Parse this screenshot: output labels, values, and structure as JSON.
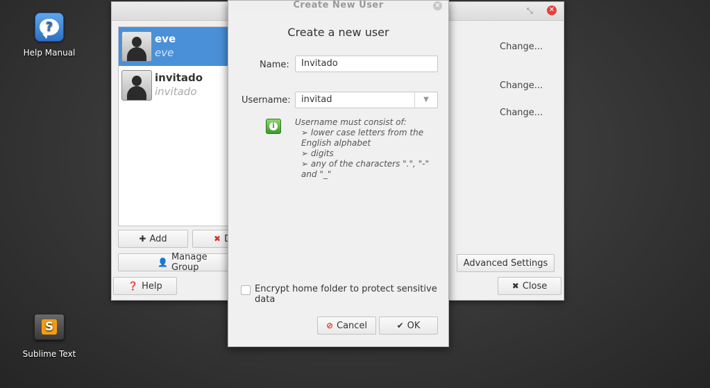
{
  "desktop": {
    "help_manual": "Help Manual",
    "sublime_text": "Sublime Text"
  },
  "users_window": {
    "users": [
      {
        "name": "eve",
        "login": "eve",
        "selected": true
      },
      {
        "name": "invitado",
        "login": "invitado",
        "selected": false
      }
    ],
    "add_label": "Add",
    "delete_label": "D",
    "manage_groups_label": "Manage Group",
    "change_labels": [
      "Change...",
      "Change...",
      "Change..."
    ],
    "advanced_settings_label": "Advanced Settings",
    "help_label": "Help",
    "close_label": "Close"
  },
  "dialog": {
    "title": "Create New User",
    "heading": "Create a new user",
    "name_label": "Name:",
    "name_value": "Invitado",
    "username_label": "Username:",
    "username_value": "invitad",
    "hint": {
      "intro": "Username must consist of:",
      "rule1": "➢  lower case letters from the English alphabet",
      "rule2": "➢  digits",
      "rule3": "➢  any of the characters \".\", \"-\" and \"_\""
    },
    "encrypt_label": "Encrypt home folder to protect sensitive data",
    "encrypt_checked": false,
    "cancel_label": "Cancel",
    "ok_label": "OK"
  }
}
